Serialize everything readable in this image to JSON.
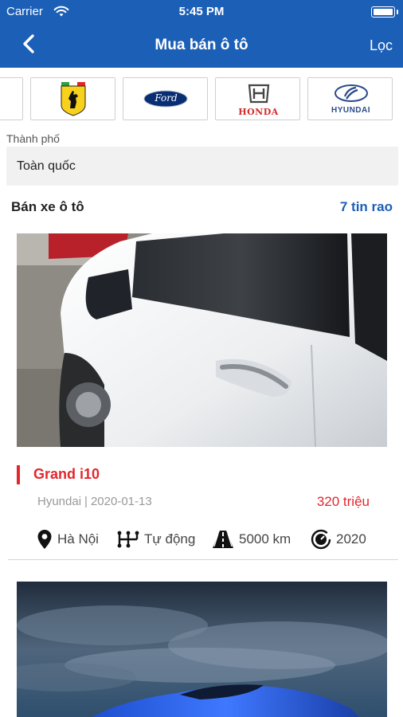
{
  "status_bar": {
    "carrier": "Carrier",
    "time": "5:45 PM"
  },
  "nav": {
    "title": "Mua bán ô tô",
    "filter_label": "Lọc"
  },
  "brands": [
    {
      "name": "Ferrari",
      "icon": "ferrari-logo"
    },
    {
      "name": "Ford",
      "icon": "ford-logo",
      "text": "Ford"
    },
    {
      "name": "Honda",
      "icon": "honda-logo",
      "text": "HONDA"
    },
    {
      "name": "Hyundai",
      "icon": "hyundai-logo",
      "text": "HYUNDAI"
    }
  ],
  "city": {
    "label": "Thành phố",
    "value": "Toàn quốc"
  },
  "section": {
    "title": "Bán xe ô tô",
    "count_text": "7 tin rao"
  },
  "listings": [
    {
      "title": "Grand i10",
      "brand": "Hyundai",
      "separator": "|",
      "date": "2020-01-13",
      "price": "320 triệu",
      "location": "Hà Nội",
      "transmission": "Tự động",
      "mileage": "5000 km",
      "year": "2020",
      "photo": "white-car-door-photo"
    },
    {
      "photo": "blue-sports-car-storm-sky-photo"
    }
  ],
  "colors": {
    "primary": "#1c5fb6",
    "accent_red": "#e4262c",
    "muted_text": "#999999"
  }
}
